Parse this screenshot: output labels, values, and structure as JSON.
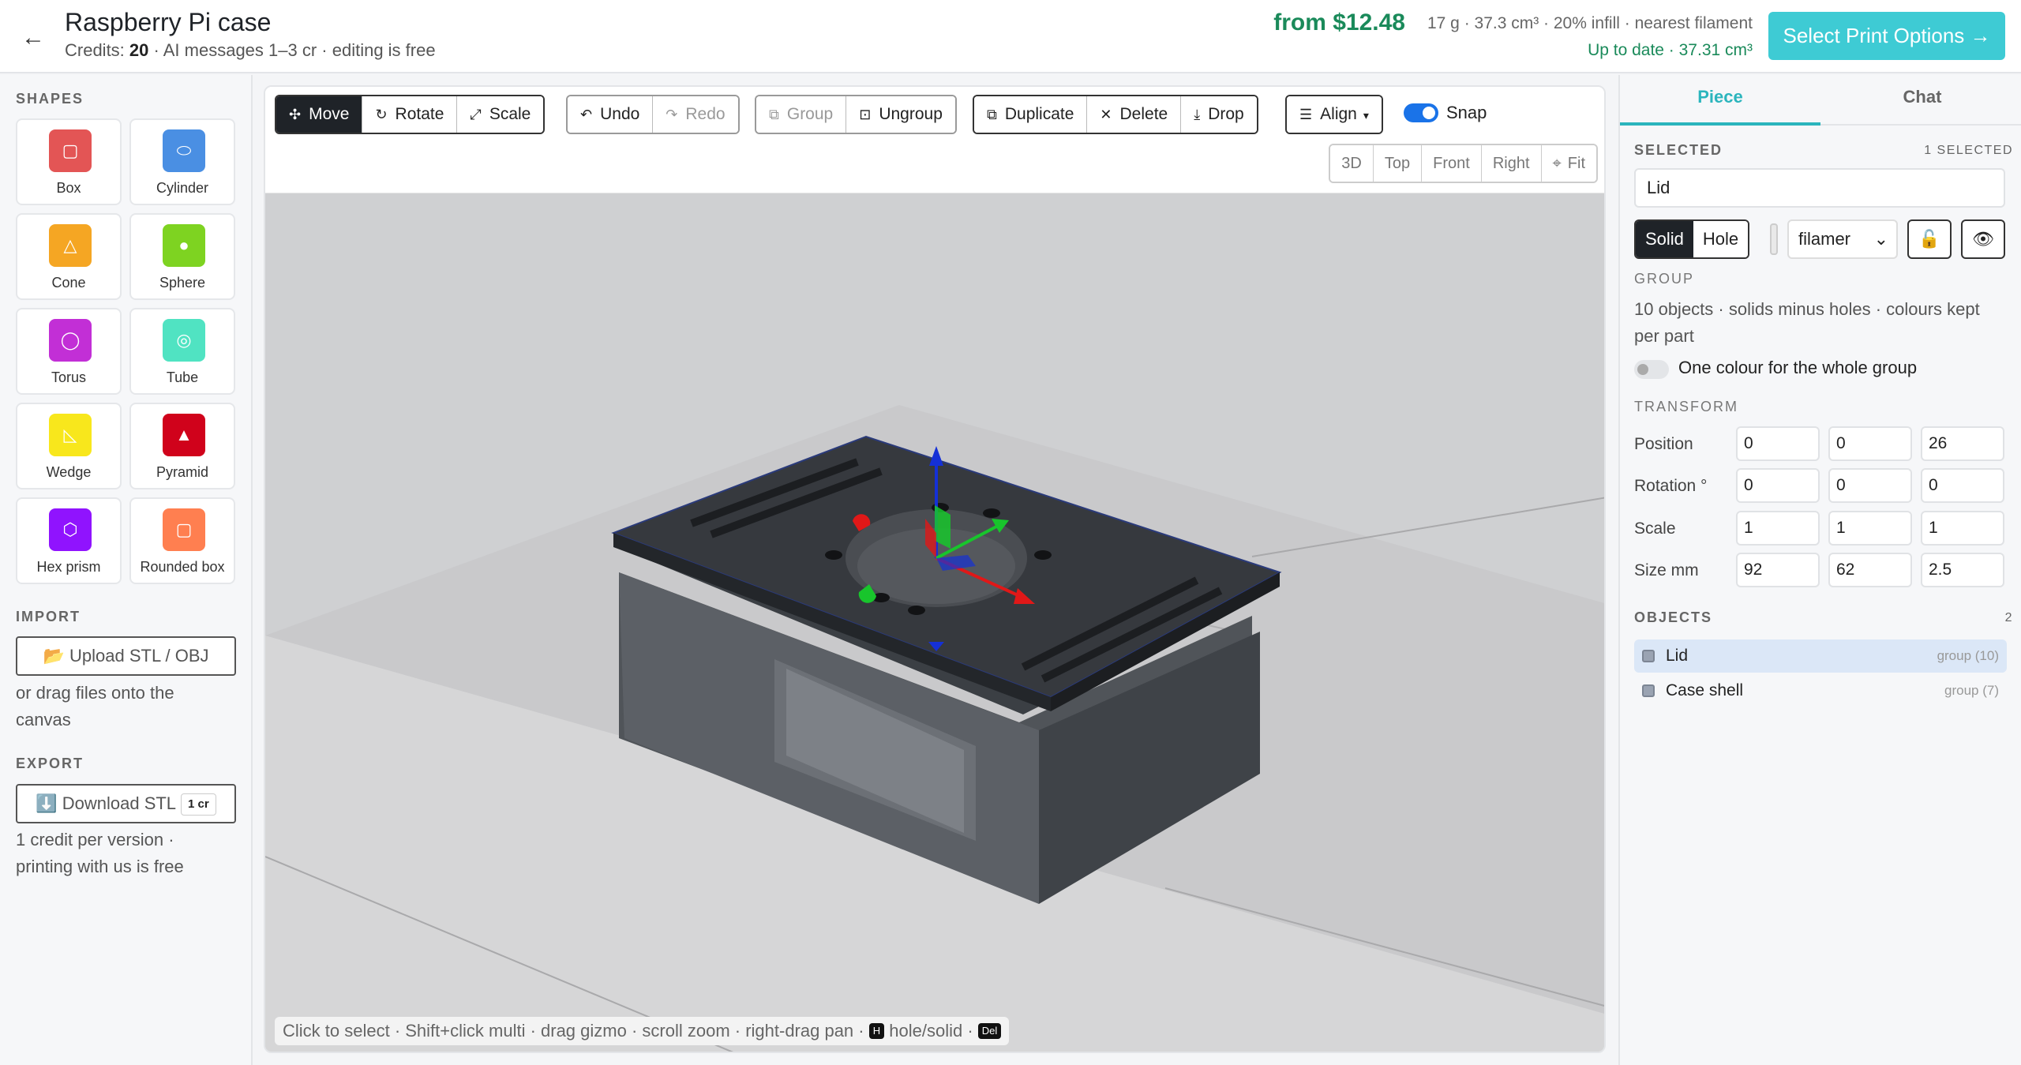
{
  "header": {
    "back_icon": "←",
    "title": "Raspberry Pi case",
    "credits_label": "Credits:",
    "credits_value": "20",
    "credits_rest": "· AI messages 1–3 cr · editing is free",
    "price": "from $12.48",
    "specs": "17 g · 37.3 cm³ · 20% infill · nearest filament",
    "status": "Up to date · 37.31 cm³",
    "print_button": "Select Print Options →"
  },
  "left": {
    "shapes_label": "SHAPES",
    "shapes": [
      {
        "label": "Box",
        "icon": "▢",
        "color": "#e35555"
      },
      {
        "label": "Cylinder",
        "icon": "⬭",
        "color": "#4a8fe3"
      },
      {
        "label": "Cone",
        "icon": "△",
        "color": "#f5a623"
      },
      {
        "label": "Sphere",
        "icon": "●",
        "color": "#7ed321"
      },
      {
        "label": "Torus",
        "icon": "◯",
        "color": "#c22fd6"
      },
      {
        "label": "Tube",
        "icon": "◎",
        "color": "#50e3c2"
      },
      {
        "label": "Wedge",
        "icon": "◺",
        "color": "#f8e71c"
      },
      {
        "label": "Pyramid",
        "icon": "▲",
        "color": "#d0021b"
      },
      {
        "label": "Hex prism",
        "icon": "⬡",
        "color": "#9013fe"
      },
      {
        "label": "Rounded box",
        "icon": "▢",
        "color": "#ff7f50"
      }
    ],
    "import_label": "IMPORT",
    "upload_button": "📂 Upload STL / OBJ",
    "import_hint": "or drag files onto the canvas",
    "export_label": "EXPORT",
    "download_button": "⬇️ Download STL",
    "download_badge": "1 cr",
    "export_hint": "1 credit per version · printing with us is free"
  },
  "toolbar": {
    "move": "Move",
    "rotate": "Rotate",
    "scale": "Scale",
    "undo": "Undo",
    "redo": "Redo",
    "group": "Group",
    "ungroup": "Ungroup",
    "duplicate": "Duplicate",
    "delete": "Delete",
    "drop": "Drop",
    "align": "Align",
    "snap": "Snap",
    "views": [
      "3D",
      "Top",
      "Front",
      "Right"
    ],
    "fit": "Fit"
  },
  "status_bar": {
    "text": "Click to select · Shift+click multi · drag gizmo · scroll zoom · right-drag pan ·",
    "hole_key": "H",
    "hole_text": "hole/solid ·",
    "del_key": "Del"
  },
  "right": {
    "tabs": [
      "Piece",
      "Chat"
    ],
    "selected_label": "SELECTED",
    "selected_count": "1 SELECTED",
    "name_value": "Lid",
    "solid": "Solid",
    "hole": "Hole",
    "material": "filamer",
    "group_label": "GROUP",
    "group_desc": "10 objects · solids minus holes · colours kept per part",
    "one_colour": "One colour for the whole group",
    "transform_label": "TRANSFORM",
    "transform": [
      {
        "label": "Position",
        "values": [
          "0",
          "0",
          "26"
        ]
      },
      {
        "label": "Rotation °",
        "values": [
          "0",
          "0",
          "0"
        ]
      },
      {
        "label": "Scale",
        "values": [
          "1",
          "1",
          "1"
        ]
      },
      {
        "label": "Size mm",
        "values": [
          "92",
          "62",
          "2.5"
        ]
      }
    ],
    "objects_label": "OBJECTS",
    "objects_count": "2",
    "objects": [
      {
        "name": "Lid",
        "meta": "group (10)"
      },
      {
        "name": "Case shell",
        "meta": "group (7)"
      }
    ]
  }
}
